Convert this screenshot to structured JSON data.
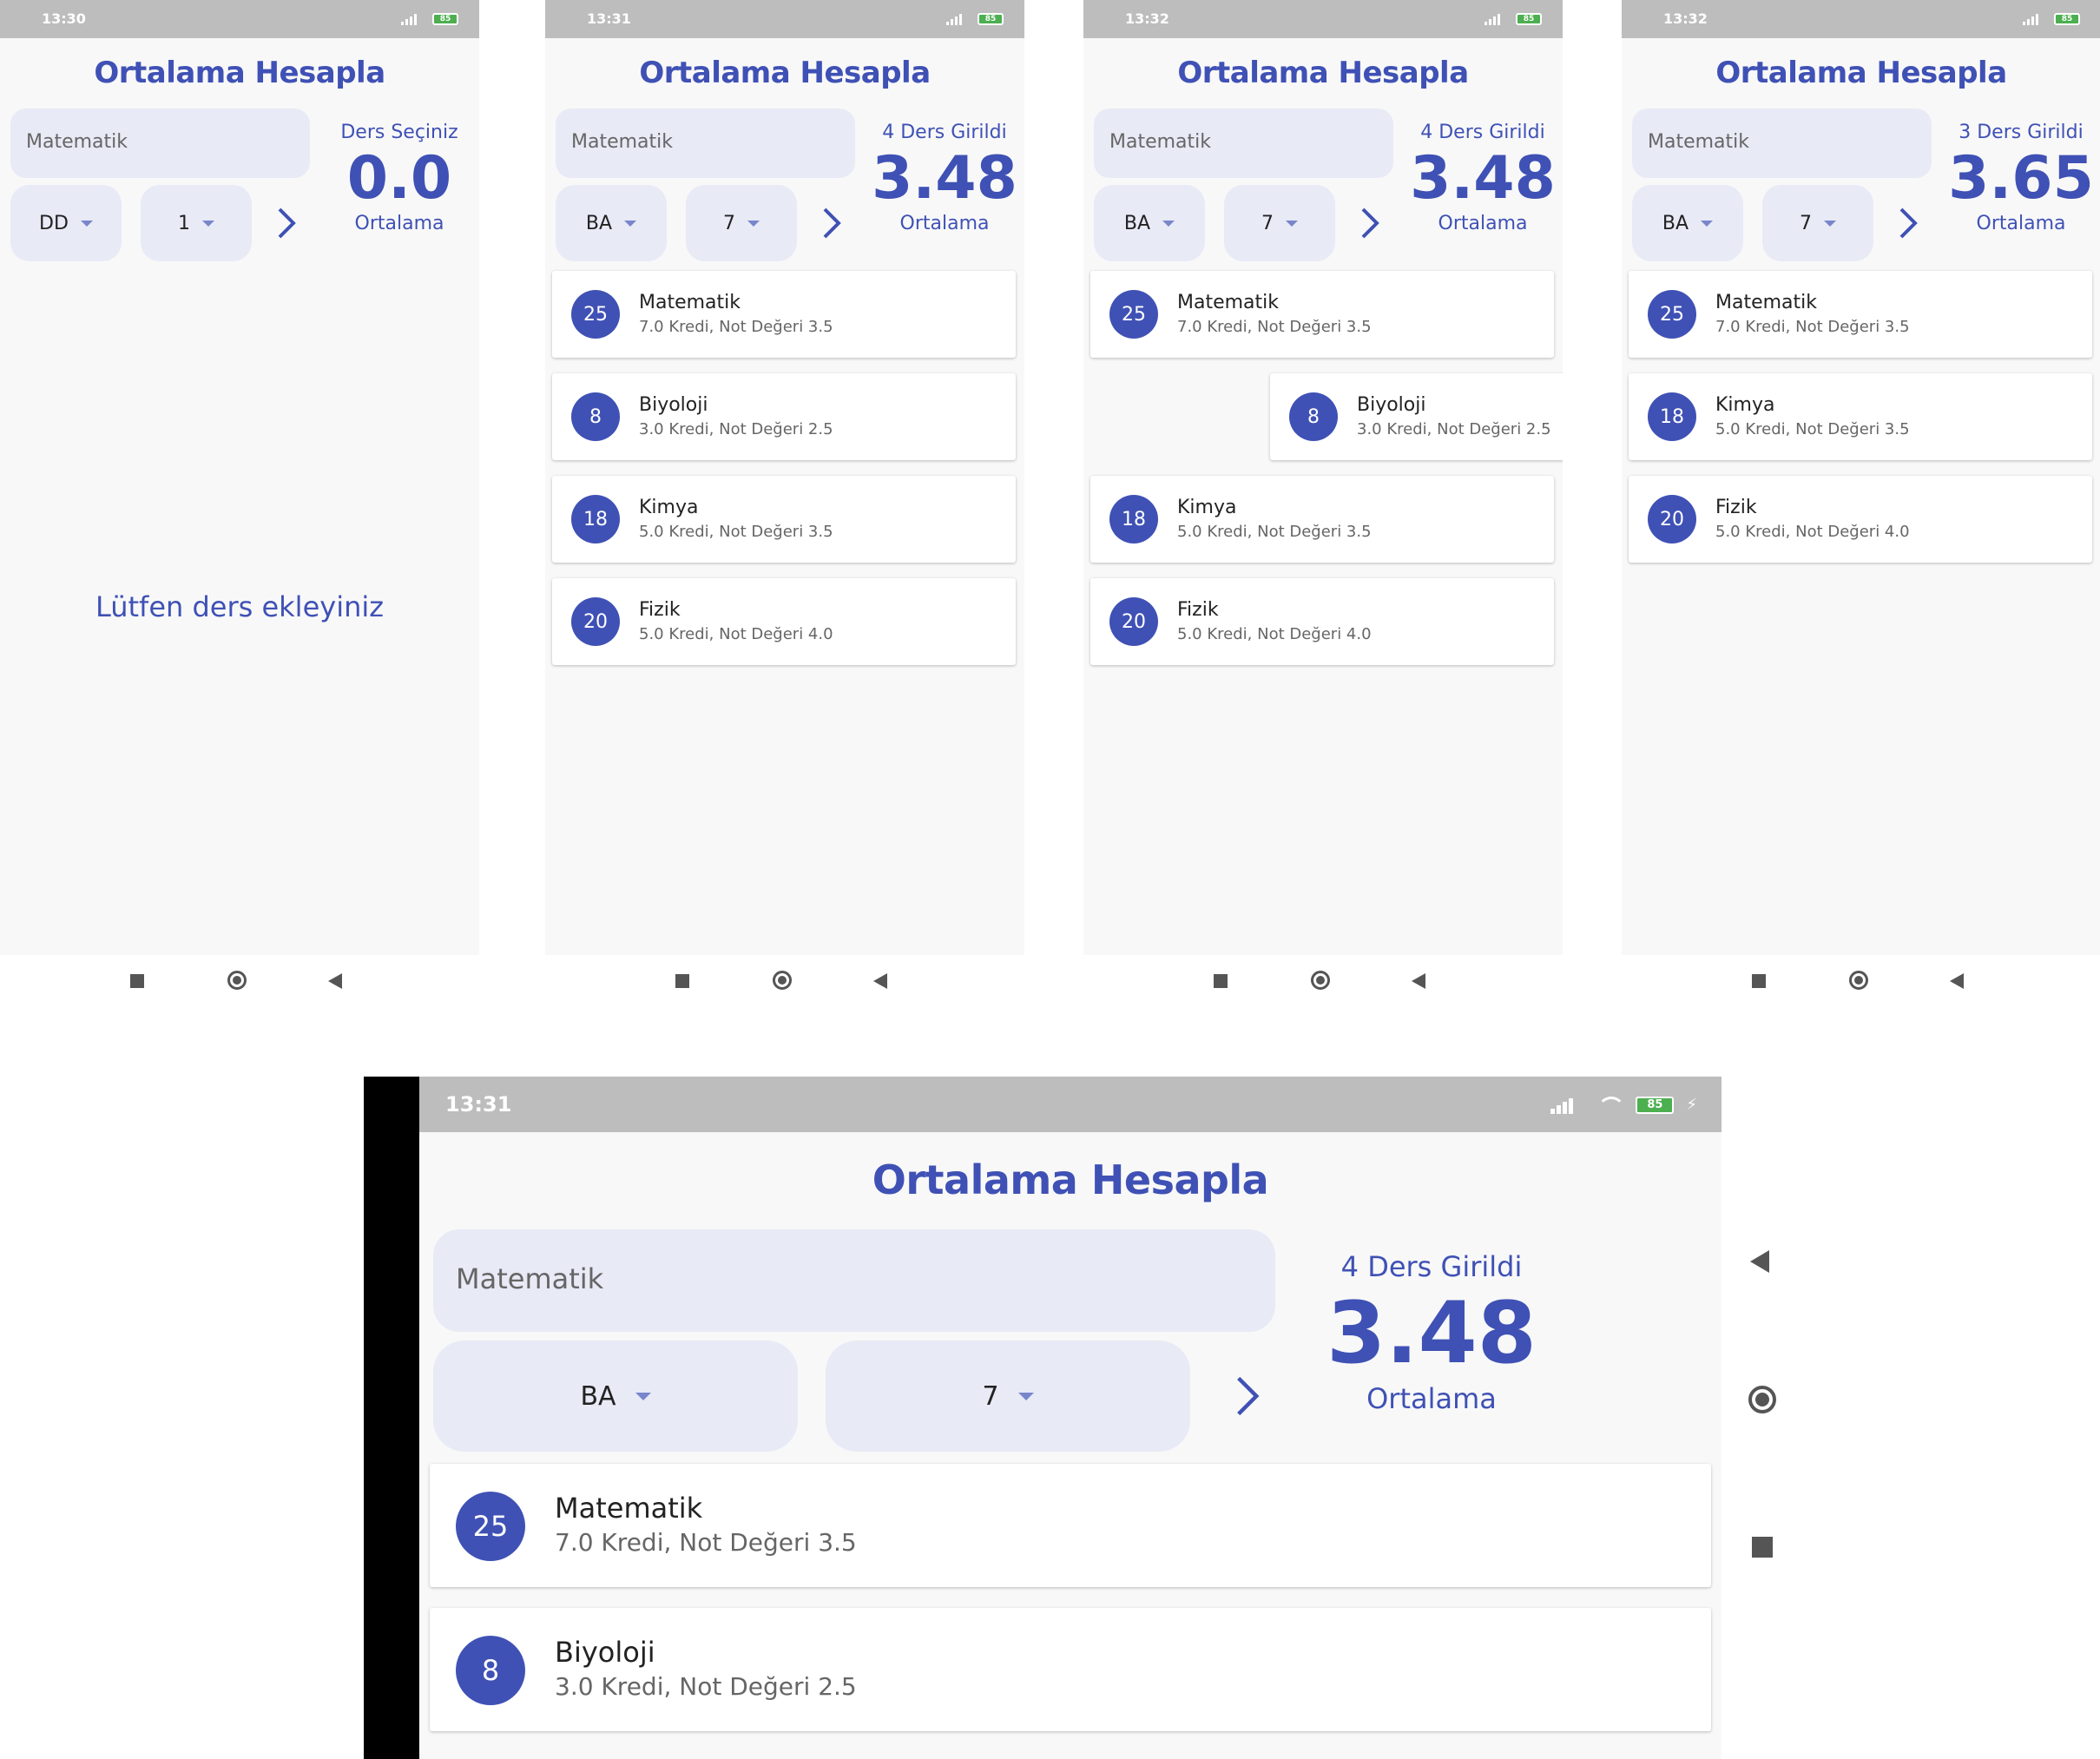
{
  "colors": {
    "primary": "#3f51b5",
    "fieldBg": "#e8eaf6",
    "statusBar": "#bdbdbd",
    "battery": "#4caf50"
  },
  "screens": [
    {
      "time": "13:30",
      "battery": "85",
      "title": "Ortalama Hesapla",
      "course_input": "Matematik",
      "grade": "DD",
      "credit": "1",
      "status": "Ders Seçiniz",
      "average": "0.0",
      "average_label": "Ortalama",
      "empty_text": "Lütfen ders ekleyiniz",
      "courses": []
    },
    {
      "time": "13:31",
      "battery": "85",
      "title": "Ortalama Hesapla",
      "course_input": "Matematik",
      "grade": "BA",
      "credit": "7",
      "status": "4 Ders Girildi",
      "average": "3.48",
      "average_label": "Ortalama",
      "courses": [
        {
          "badge": "25",
          "name": "Matematik",
          "detail": "7.0 Kredi, Not Değeri 3.5"
        },
        {
          "badge": "8",
          "name": "Biyoloji",
          "detail": "3.0 Kredi, Not Değeri 2.5"
        },
        {
          "badge": "18",
          "name": "Kimya",
          "detail": "5.0 Kredi, Not Değeri 3.5"
        },
        {
          "badge": "20",
          "name": "Fizik",
          "detail": "5.0 Kredi, Not Değeri 4.0"
        }
      ]
    },
    {
      "time": "13:32",
      "battery": "85",
      "title": "Ortalama Hesapla",
      "course_input": "Matematik",
      "grade": "BA",
      "credit": "7",
      "status": "4 Ders Girildi",
      "average": "3.48",
      "average_label": "Ortalama",
      "courses": [
        {
          "badge": "25",
          "name": "Matematik",
          "detail": "7.0 Kredi, Not Değeri 3.5"
        },
        {
          "badge": "8",
          "name": "Biyoloji",
          "detail": "3.0 Kredi, Not Değeri 2.5",
          "swiping": true
        },
        {
          "badge": "18",
          "name": "Kimya",
          "detail": "5.0 Kredi, Not Değeri 3.5"
        },
        {
          "badge": "20",
          "name": "Fizik",
          "detail": "5.0 Kredi, Not Değeri 4.0"
        }
      ]
    },
    {
      "time": "13:32",
      "battery": "85",
      "title": "Ortalama Hesapla",
      "course_input": "Matematik",
      "grade": "BA",
      "credit": "7",
      "status": "3 Ders Girildi",
      "average": "3.65",
      "average_label": "Ortalama",
      "courses": [
        {
          "badge": "25",
          "name": "Matematik",
          "detail": "7.0 Kredi, Not Değeri 3.5"
        },
        {
          "badge": "18",
          "name": "Kimya",
          "detail": "5.0 Kredi, Not Değeri 3.5"
        },
        {
          "badge": "20",
          "name": "Fizik",
          "detail": "5.0 Kredi, Not Değeri 4.0"
        }
      ]
    }
  ],
  "landscape": {
    "time": "13:31",
    "battery": "85",
    "title": "Ortalama Hesapla",
    "course_input": "Matematik",
    "grade": "BA",
    "credit": "7",
    "status": "4 Ders Girildi",
    "average": "3.48",
    "average_label": "Ortalama",
    "courses": [
      {
        "badge": "25",
        "name": "Matematik",
        "detail": "7.0 Kredi, Not Değeri 3.5"
      },
      {
        "badge": "8",
        "name": "Biyoloji",
        "detail": "3.0 Kredi, Not Değeri 2.5"
      }
    ]
  },
  "icons": {
    "next": "chevron-right-icon",
    "dropdown": "caret-down-icon",
    "nav_recents": "square-icon",
    "nav_home": "circle-icon",
    "nav_back": "triangle-back-icon"
  }
}
